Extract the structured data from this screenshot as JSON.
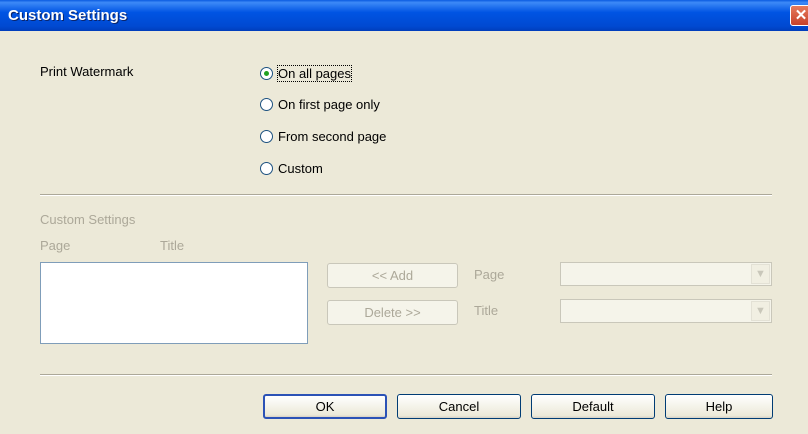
{
  "window": {
    "title": "Custom Settings",
    "close_label": "✕"
  },
  "watermark": {
    "label": "Print Watermark",
    "options": [
      {
        "label": "On all pages",
        "checked": true
      },
      {
        "label": "On first page only",
        "checked": false
      },
      {
        "label": "From second page",
        "checked": false
      },
      {
        "label": "Custom",
        "checked": false
      }
    ]
  },
  "custom": {
    "group_label": "Custom Settings",
    "col_page": "Page",
    "col_title": "Title",
    "add_button": "<< Add",
    "delete_button": "Delete >>",
    "page_label": "Page",
    "title_label": "Title",
    "page_value": "",
    "title_value": ""
  },
  "footer": {
    "ok": "OK",
    "cancel": "Cancel",
    "default": "Default",
    "help": "Help"
  },
  "icons": {
    "close": "close-icon",
    "dropdown": "chevron-down-icon"
  }
}
